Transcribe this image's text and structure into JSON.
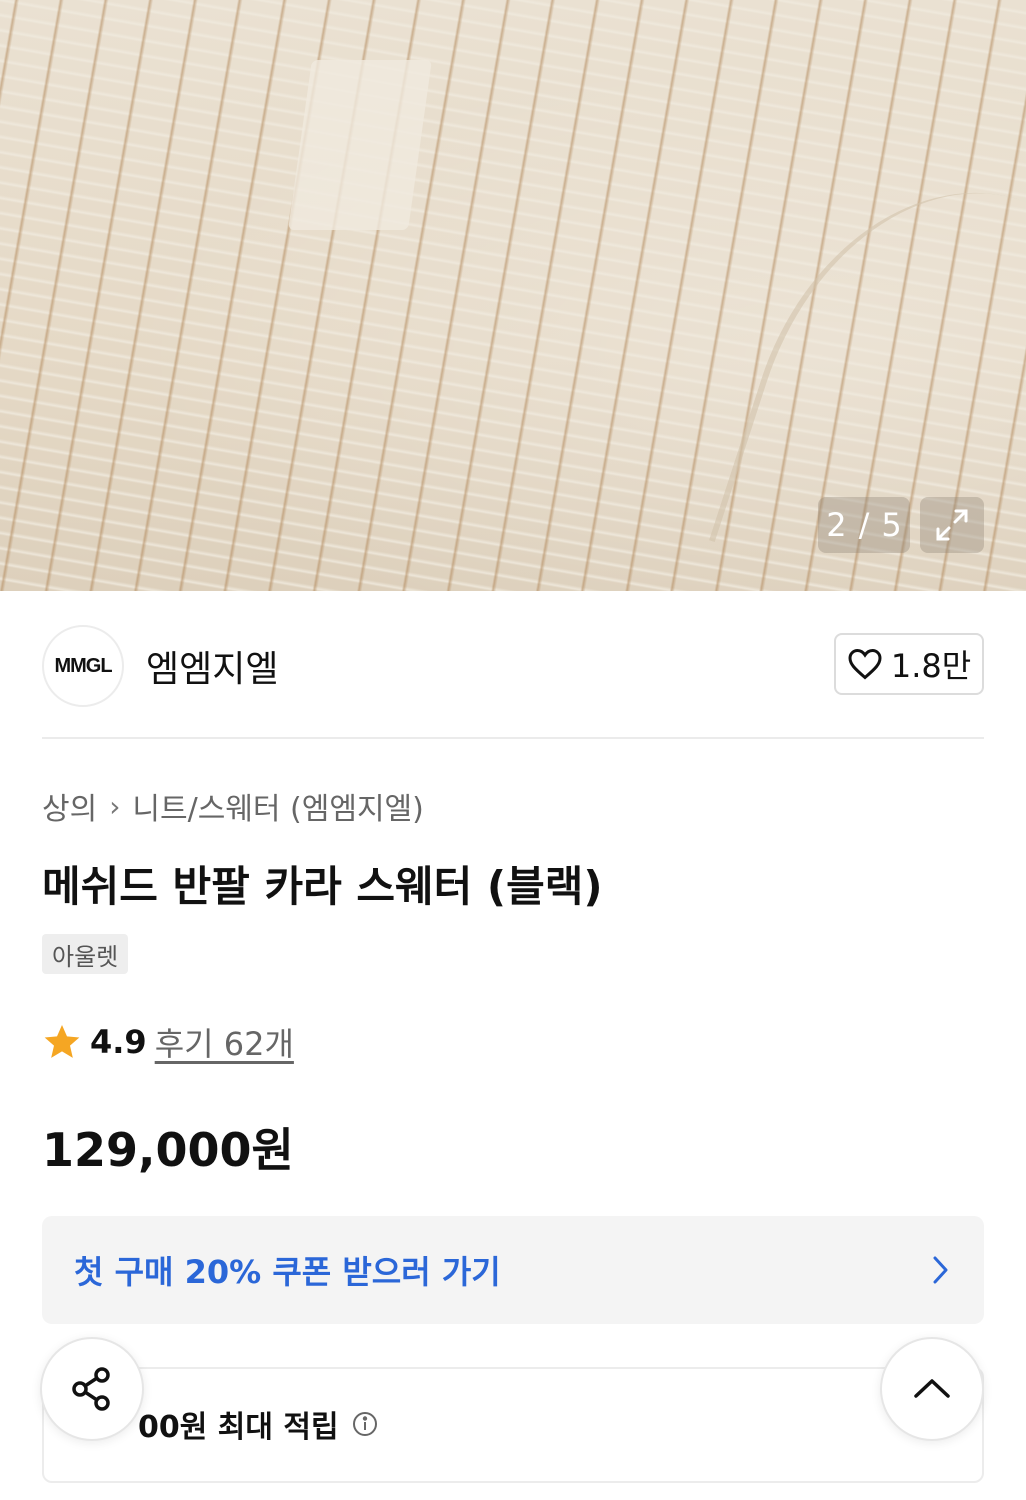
{
  "gallery": {
    "current": "2",
    "separator": "/",
    "total": "5"
  },
  "brand": {
    "logo_text": "MMGL",
    "name": "엠엠지엘",
    "likes": "1.8만"
  },
  "breadcrumb": {
    "category": "상의",
    "separator": "›",
    "subcategory": "니트/스웨터 (엠엠지엘)"
  },
  "product": {
    "title": "메쉬드 반팔 카라 스웨터 (블랙)",
    "tag": "아울렛",
    "rating": "4.9",
    "reviews": "후기 62개",
    "price": "129,000원"
  },
  "coupon": {
    "label": "첫 구매 20% 쿠폰 받으러 가기"
  },
  "points": {
    "label": "00원 최대 적립"
  },
  "colors": {
    "accent_blue": "#2b67d8",
    "star": "#f5a623"
  }
}
